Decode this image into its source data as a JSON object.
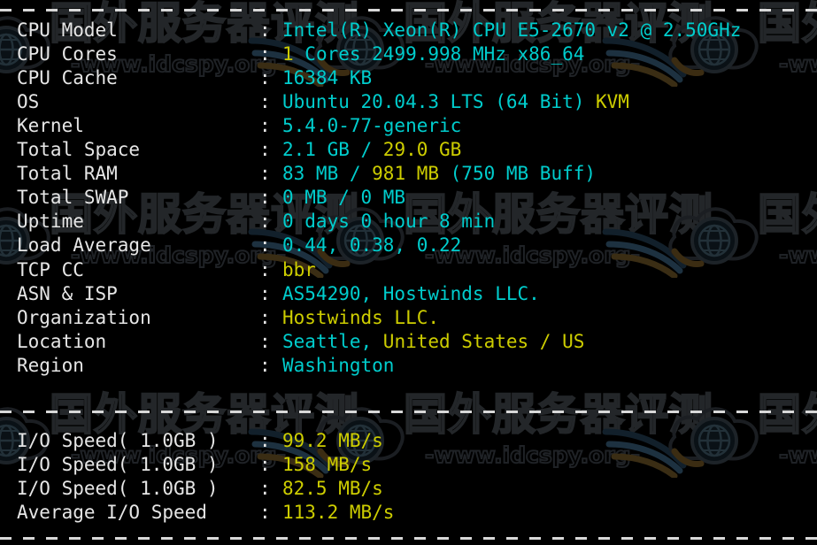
{
  "terminal": {
    "background_color": "#000000",
    "colors": {
      "cyan": "#00cdcd",
      "yellow": "#cdcd00",
      "white": "#e6e6e6",
      "rule": "#d8d8d8"
    },
    "separators": {
      "top_rule": "----------------------------------------------------------------------",
      "middle_rule": "----------------------------------------------------------------------",
      "bottom_rule": "----------------------------------------------------------------------"
    },
    "colon": ":",
    "system_info": [
      {
        "label": "CPU Model",
        "value": "Intel(R) Xeon(R) CPU E5-2670 v2 @ 2.50GHz",
        "parts": [
          {
            "text": "Intel(R) Xeon(R) CPU E5-2670 v2 @ 2.50GHz",
            "color": "cyan"
          }
        ]
      },
      {
        "label": "CPU Cores",
        "value": "1 Cores 2499.998 MHz x86_64",
        "parts": [
          {
            "text": "1",
            "color": "yellow"
          },
          {
            "text": " Cores 2499.998 MHz x86_64",
            "color": "cyan"
          }
        ]
      },
      {
        "label": "CPU Cache",
        "value": "16384 KB",
        "parts": [
          {
            "text": "16384 KB",
            "color": "cyan"
          }
        ]
      },
      {
        "label": "OS",
        "value": "Ubuntu 20.04.3 LTS (64 Bit) KVM",
        "parts": [
          {
            "text": "Ubuntu 20.04.3 LTS (64 Bit) ",
            "color": "cyan"
          },
          {
            "text": "KVM",
            "color": "yellow"
          }
        ]
      },
      {
        "label": "Kernel",
        "value": "5.4.0-77-generic",
        "parts": [
          {
            "text": "5.4.0-77-generic",
            "color": "cyan"
          }
        ]
      },
      {
        "label": "Total Space",
        "value": "2.1 GB / 29.0 GB",
        "parts": [
          {
            "text": "2.1 GB / ",
            "color": "cyan"
          },
          {
            "text": "29.0 GB",
            "color": "yellow"
          }
        ]
      },
      {
        "label": "Total RAM",
        "value": "83 MB / 981 MB (750 MB Buff)",
        "parts": [
          {
            "text": "83 MB / ",
            "color": "cyan"
          },
          {
            "text": "981 MB",
            "color": "yellow"
          },
          {
            "text": " (750 MB Buff)",
            "color": "cyan"
          }
        ]
      },
      {
        "label": "Total SWAP",
        "value": "0 MB / 0 MB",
        "parts": [
          {
            "text": "0 MB / 0 MB",
            "color": "cyan"
          }
        ]
      },
      {
        "label": "Uptime",
        "value": "0 days 0 hour 8 min",
        "parts": [
          {
            "text": "0 days 0 hour 8 min",
            "color": "cyan"
          }
        ]
      },
      {
        "label": "Load Average",
        "value": "0.44, 0.38, 0.22",
        "parts": [
          {
            "text": "0.44, 0.38, 0.22",
            "color": "cyan"
          }
        ]
      },
      {
        "label": "TCP CC",
        "value": "bbr",
        "parts": [
          {
            "text": "bbr",
            "color": "yellow"
          }
        ]
      },
      {
        "label": "ASN & ISP",
        "value": "AS54290, Hostwinds LLC.",
        "parts": [
          {
            "text": "AS54290, Hostwinds LLC.",
            "color": "cyan"
          }
        ]
      },
      {
        "label": "Organization",
        "value": "Hostwinds LLC.",
        "parts": [
          {
            "text": "Hostwinds LLC.",
            "color": "yellow"
          }
        ]
      },
      {
        "label": "Location",
        "value": "Seattle, United States / US",
        "parts": [
          {
            "text": "Seattle, ",
            "color": "cyan"
          },
          {
            "text": "United States / US",
            "color": "yellow"
          }
        ]
      },
      {
        "label": "Region",
        "value": "Washington",
        "parts": [
          {
            "text": "Washington",
            "color": "cyan"
          }
        ]
      }
    ],
    "io_results": [
      {
        "label": "I/O Speed( 1.0GB )",
        "value": "99.2 MB/s",
        "parts": [
          {
            "text": "99.2 MB/s",
            "color": "yellow"
          }
        ]
      },
      {
        "label": "I/O Speed( 1.0GB )",
        "value": "158 MB/s",
        "parts": [
          {
            "text": "158 MB/s",
            "color": "yellow"
          }
        ]
      },
      {
        "label": "I/O Speed( 1.0GB )",
        "value": "82.5 MB/s",
        "parts": [
          {
            "text": "82.5 MB/s",
            "color": "yellow"
          }
        ]
      },
      {
        "label": "Average I/O Speed",
        "value": "113.2 MB/s",
        "parts": [
          {
            "text": "113.2 MB/s",
            "color": "yellow"
          }
        ]
      }
    ]
  },
  "watermark": {
    "chinese_text": "国外服务器评测",
    "url_text": "-www.idcspy.org-"
  }
}
